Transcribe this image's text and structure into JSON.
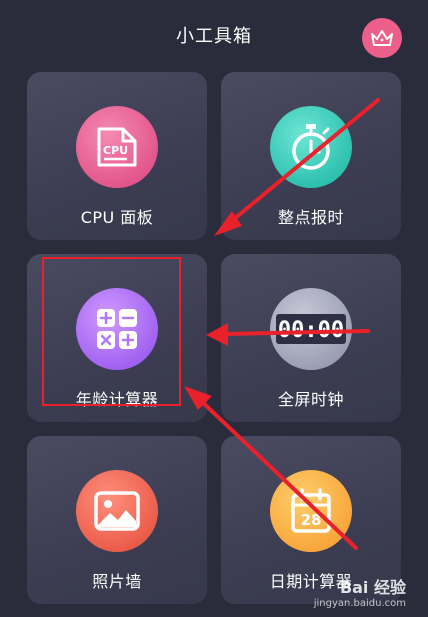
{
  "header": {
    "title": "小工具箱"
  },
  "icons": {
    "vip": "crown-icon"
  },
  "tools": [
    {
      "label": "CPU 面板",
      "icon": "cpu-chip-icon",
      "color": "#e2538a"
    },
    {
      "label": "整点报时",
      "icon": "stopwatch-icon",
      "color": "#2bbfae"
    },
    {
      "label": "年龄计算器",
      "icon": "calculator-icon",
      "color": "#9f5ff0"
    },
    {
      "label": "全屏时钟",
      "icon": "digital-clock-icon",
      "color": "#9a9cb2"
    },
    {
      "label": "照片墙",
      "icon": "photo-icon",
      "color": "#ea5a48"
    },
    {
      "label": "日期计算器",
      "icon": "calendar-icon",
      "color": "#f7a53a"
    }
  ],
  "clock_text": "00:00",
  "calendar_text": "28",
  "cpu_text": "CPU",
  "watermark": {
    "main": "Bai 经验",
    "sub": "jingyan.baidu.com"
  },
  "annotation_color": "#e8212a"
}
